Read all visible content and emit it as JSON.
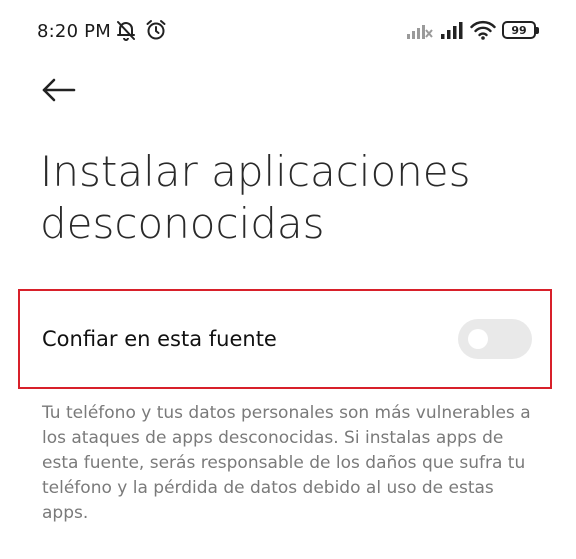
{
  "status_bar": {
    "time": "8:20 PM",
    "battery_level": "99",
    "icons": [
      "bell-off-icon",
      "alarm-clock-icon",
      "signal-no-service-icon",
      "signal-icon",
      "wifi-icon",
      "battery-icon"
    ]
  },
  "header": {
    "back_icon": "arrow-left-icon"
  },
  "page": {
    "title": "Instalar aplicaciones desconocidas"
  },
  "setting": {
    "label": "Confiar en esta fuente",
    "toggle_state": "off",
    "highlight_color": "#d8202a"
  },
  "description": "Tu teléfono y tus datos personales son más vulnerables a los ataques de apps desconocidas. Si instalas apps de esta fuente, serás responsable de los daños que sufra tu teléfono y la pérdida de datos debido al uso de estas apps."
}
